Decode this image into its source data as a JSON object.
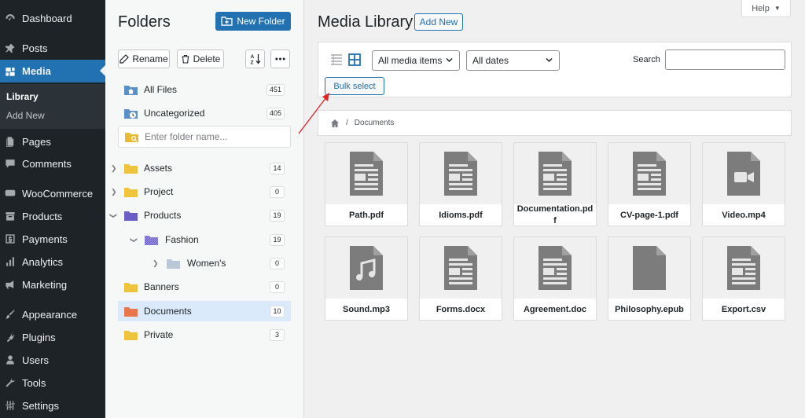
{
  "admin_menu": {
    "items": [
      {
        "label": "Dashboard",
        "icon": "dashboard-icon"
      },
      {
        "label": "Posts",
        "icon": "pin-icon"
      },
      {
        "label": "Media",
        "icon": "media-icon"
      },
      {
        "label": "Pages",
        "icon": "pages-icon"
      },
      {
        "label": "Comments",
        "icon": "comment-icon"
      },
      {
        "label": "WooCommerce",
        "icon": "woo-icon"
      },
      {
        "label": "Products",
        "icon": "archive-icon"
      },
      {
        "label": "Payments",
        "icon": "dollar-icon"
      },
      {
        "label": "Analytics",
        "icon": "bar-chart-icon"
      },
      {
        "label": "Marketing",
        "icon": "megaphone-icon"
      },
      {
        "label": "Appearance",
        "icon": "brush-icon"
      },
      {
        "label": "Plugins",
        "icon": "plug-icon"
      },
      {
        "label": "Users",
        "icon": "user-icon"
      },
      {
        "label": "Tools",
        "icon": "wrench-icon"
      },
      {
        "label": "Settings",
        "icon": "sliders-icon"
      }
    ],
    "submenu": [
      "Library",
      "Add New"
    ],
    "accent": "#2271b1"
  },
  "folders": {
    "title": "Folders",
    "new_folder": "New Folder",
    "rename": "Rename",
    "delete": "Delete",
    "input_placeholder": "Enter folder name...",
    "all_files": {
      "label": "All Files",
      "count": "451"
    },
    "uncategorized": {
      "label": "Uncategorized",
      "count": "405"
    },
    "tree": [
      {
        "label": "Assets",
        "count": "14"
      },
      {
        "label": "Project",
        "count": "0"
      },
      {
        "label": "Products",
        "count": "19"
      },
      {
        "label": "Fashion",
        "count": "19"
      },
      {
        "label": "Women's",
        "count": "0"
      },
      {
        "label": "Banners",
        "count": "0"
      },
      {
        "label": "Documents",
        "count": "10"
      },
      {
        "label": "Private",
        "count": "3"
      }
    ]
  },
  "media": {
    "title": "Media Library",
    "add_new": "Add New",
    "help": "Help",
    "filter_type": "All media items",
    "filter_date": "All dates",
    "search_label": "Search",
    "bulk_select": "Bulk select",
    "breadcrumb": "Documents",
    "files": [
      {
        "name": "Path.pdf",
        "icon": "document-icon"
      },
      {
        "name": "Idioms.pdf",
        "icon": "document-icon"
      },
      {
        "name": "Documentation.pdf",
        "icon": "document-icon"
      },
      {
        "name": "CV-page-1.pdf",
        "icon": "document-icon"
      },
      {
        "name": "Video.mp4",
        "icon": "video-icon"
      },
      {
        "name": "Sound.mp3",
        "icon": "audio-icon"
      },
      {
        "name": "Forms.docx",
        "icon": "document-icon"
      },
      {
        "name": "Agreement.doc",
        "icon": "document-icon"
      },
      {
        "name": "Philosophy.epub",
        "icon": "blank-file-icon"
      },
      {
        "name": "Export.csv",
        "icon": "document-icon"
      }
    ]
  }
}
